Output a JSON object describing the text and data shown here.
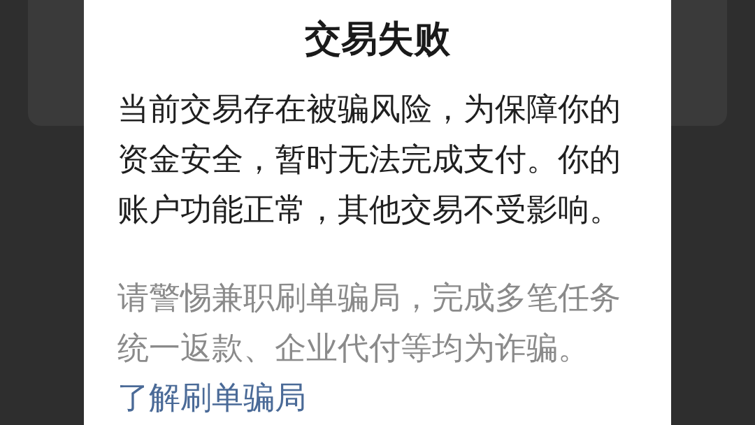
{
  "dialog": {
    "title": "交易失败",
    "message": "当前交易存在被骗风险，为保障你的资金安全，暂时无法完成支付。你的账户功能正常，其他交易不受影响。",
    "warning": "请警惕兼职刷单骗局，完成多笔任务统一返款、企业代付等均为诈骗。",
    "link": "了解刷单骗局"
  }
}
